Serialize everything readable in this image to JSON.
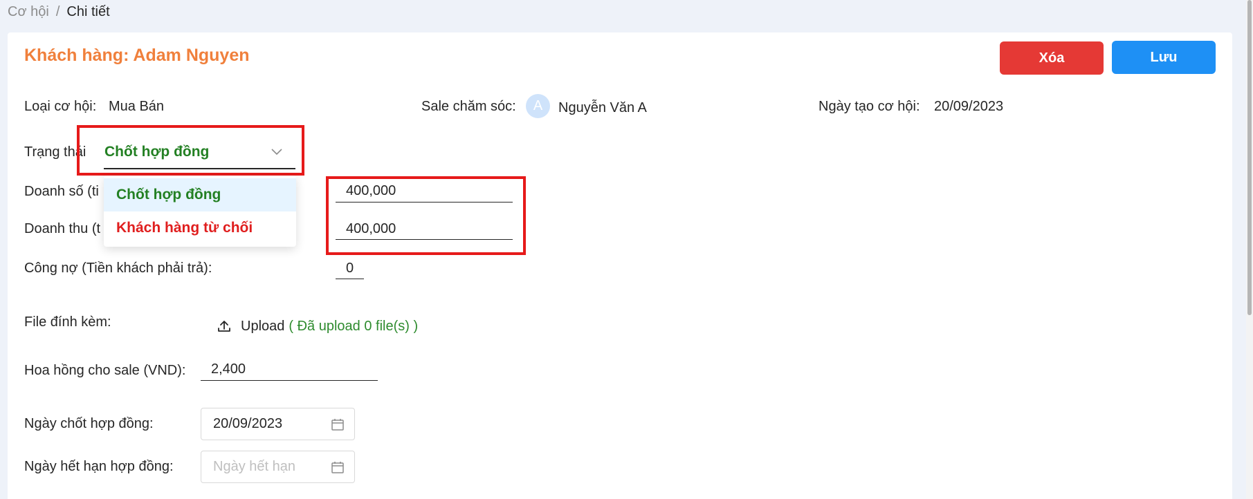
{
  "breadcrumb": {
    "items": [
      "Cơ hội",
      "Chi tiết"
    ],
    "separator": "/"
  },
  "header": {
    "title": "Khách hàng: Adam Nguyen",
    "delete_label": "Xóa",
    "save_label": "Lưu"
  },
  "info": {
    "type_label": "Loại cơ hội:",
    "type_value": "Mua Bán",
    "sale_label": "Sale chăm sóc:",
    "sale_avatar": "A",
    "sale_value": "Nguyễn Văn A",
    "created_label": "Ngày tạo cơ hội:",
    "created_value": "20/09/2023"
  },
  "status": {
    "label": "Trạng thái",
    "selected": "Chốt hợp đồng",
    "options": [
      "Chốt hợp đồng",
      "Khách hàng từ chối"
    ]
  },
  "revenue": {
    "sales_label_visible": "Doanh số (ti",
    "sales_value": "400,000",
    "income_label_visible": "Doanh thu (t",
    "income_value": "400,000"
  },
  "debt": {
    "label": "Công nợ (Tiền khách phải trả):",
    "value": "0"
  },
  "attachment": {
    "label": "File đính kèm:",
    "upload_label": "Upload",
    "upload_status": "( Đã upload 0 file(s) )"
  },
  "commission": {
    "label": "Hoa hồng cho sale (VND):",
    "value": "2,400"
  },
  "contract_date": {
    "label": "Ngày chốt hợp đồng:",
    "value": "20/09/2023"
  },
  "expiry_date": {
    "label": "Ngày hết hạn hợp đồng:",
    "placeholder": "Ngày hết hạn"
  },
  "colors": {
    "title": "#f0803c",
    "delete": "#e53935",
    "save": "#1e90f5",
    "status_green": "#238023",
    "reject_red": "#e01e1e",
    "highlight_box": "#e61a1a"
  },
  "icons": {
    "dropdown": "chevron-down-icon",
    "upload": "upload-icon",
    "calendar": "calendar-icon"
  }
}
